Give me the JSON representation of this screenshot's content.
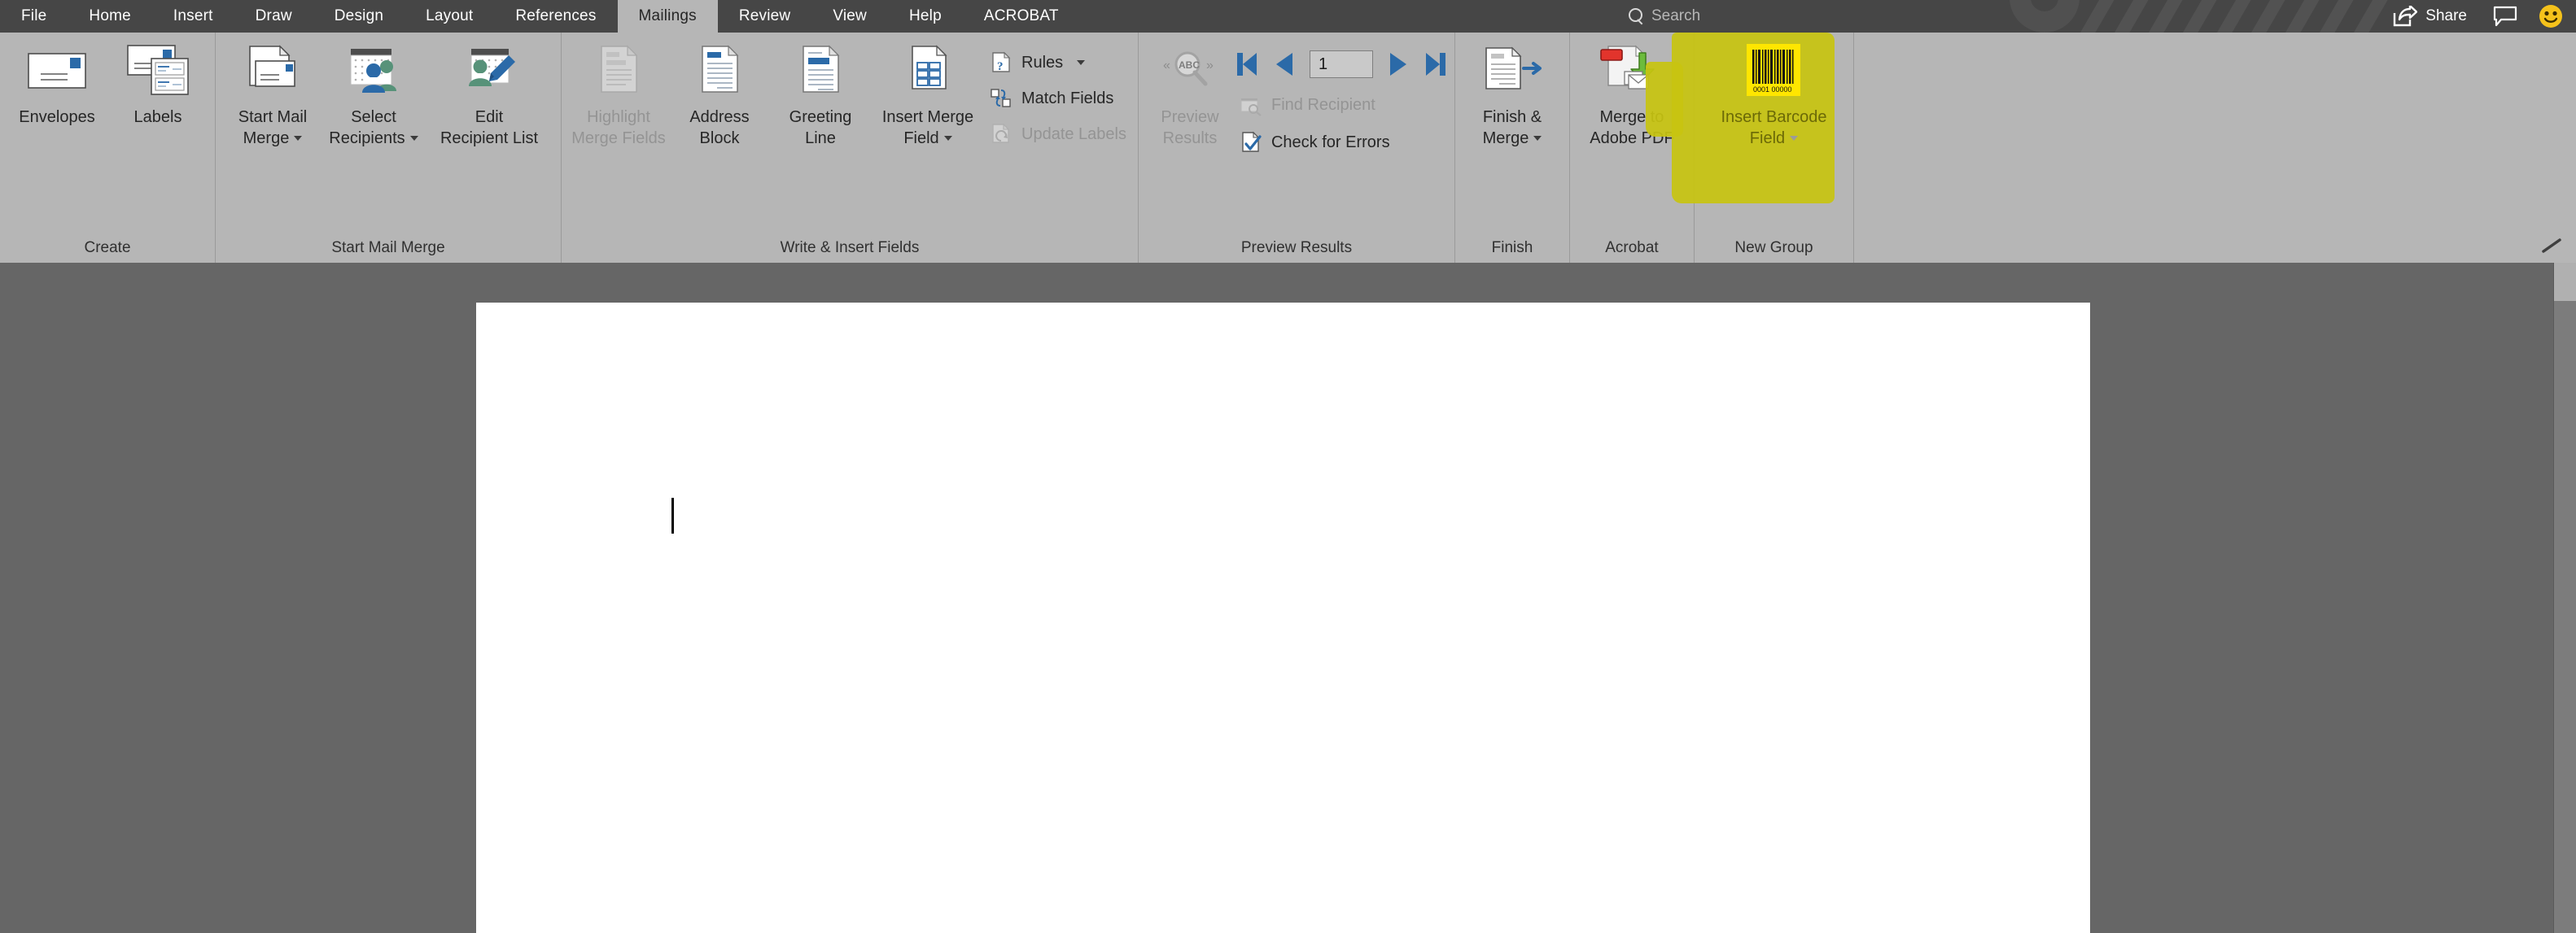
{
  "titlebar": {
    "tabs": [
      {
        "label": "File",
        "active": false
      },
      {
        "label": "Home",
        "active": false
      },
      {
        "label": "Insert",
        "active": false
      },
      {
        "label": "Draw",
        "active": false
      },
      {
        "label": "Design",
        "active": false
      },
      {
        "label": "Layout",
        "active": false
      },
      {
        "label": "References",
        "active": false
      },
      {
        "label": "Mailings",
        "active": true
      },
      {
        "label": "Review",
        "active": false
      },
      {
        "label": "View",
        "active": false
      },
      {
        "label": "Help",
        "active": false
      },
      {
        "label": "ACROBAT",
        "active": false
      }
    ],
    "search_placeholder": "Search",
    "search_icon": "search-icon",
    "share_label": "Share",
    "share_icon": "share-arrow-icon",
    "comments_icon": "comment-bubble-icon",
    "account_icon": "smiley-face-icon",
    "background_color": "#464646",
    "active_tab_color": "#b6b6b6"
  },
  "ribbon": {
    "background_color": "#b6b6b6",
    "collapse_icon": "collapse-ribbon-arrow-icon",
    "groups": [
      {
        "name": "create",
        "label": "Create",
        "buttons": [
          {
            "id": "envelopes",
            "label": "Envelopes",
            "icon": "envelope-icon",
            "disabled": false,
            "dropdown": false
          },
          {
            "id": "labels",
            "label": "Labels",
            "icon": "labels-icon",
            "disabled": false,
            "dropdown": false
          }
        ]
      },
      {
        "name": "start-mail-merge",
        "label": "Start Mail Merge",
        "buttons": [
          {
            "id": "start-mail-merge",
            "label": "Start Mail\nMerge",
            "icon": "start-mail-merge-icon",
            "disabled": false,
            "dropdown": true
          },
          {
            "id": "select-recipients",
            "label": "Select\nRecipients",
            "icon": "select-recipients-icon",
            "disabled": false,
            "dropdown": true
          },
          {
            "id": "edit-recipient-list",
            "label": "Edit\nRecipient List",
            "icon": "edit-recipient-list-icon",
            "disabled": false,
            "dropdown": false
          }
        ]
      },
      {
        "name": "write-insert-fields",
        "label": "Write & Insert Fields",
        "buttons": [
          {
            "id": "highlight-merge-fields",
            "label": "Highlight\nMerge Fields",
            "icon": "highlight-merge-fields-icon",
            "disabled": true,
            "dropdown": false
          },
          {
            "id": "address-block",
            "label": "Address\nBlock",
            "icon": "address-block-icon",
            "disabled": false,
            "dropdown": false
          },
          {
            "id": "greeting-line",
            "label": "Greeting\nLine",
            "icon": "greeting-line-icon",
            "disabled": false,
            "dropdown": false
          },
          {
            "id": "insert-merge-field",
            "label": "Insert Merge\nField",
            "icon": "insert-merge-field-icon",
            "disabled": false,
            "dropdown": true
          }
        ],
        "small_buttons": [
          {
            "id": "rules",
            "label": "Rules",
            "icon": "rules-icon",
            "disabled": false,
            "dropdown": true
          },
          {
            "id": "match-fields",
            "label": "Match Fields",
            "icon": "match-fields-icon",
            "disabled": false,
            "dropdown": false
          },
          {
            "id": "update-labels",
            "label": "Update Labels",
            "icon": "update-labels-icon",
            "disabled": true,
            "dropdown": false
          }
        ]
      },
      {
        "name": "preview-results",
        "label": "Preview Results",
        "buttons": [
          {
            "id": "preview-results",
            "label": "Preview\nResults",
            "icon": "preview-results-icon",
            "disabled": true,
            "dropdown": false
          }
        ],
        "navigation": {
          "first_icon": "first-record-icon",
          "previous_icon": "previous-record-icon",
          "record_number": "1",
          "next_icon": "next-record-icon",
          "last_icon": "last-record-icon"
        },
        "small_buttons": [
          {
            "id": "find-recipient",
            "label": "Find Recipient",
            "icon": "find-recipient-icon",
            "disabled": true,
            "dropdown": false
          },
          {
            "id": "check-for-errors",
            "label": "Check for Errors",
            "icon": "check-for-errors-icon",
            "disabled": false,
            "dropdown": false
          }
        ]
      },
      {
        "name": "finish",
        "label": "Finish",
        "buttons": [
          {
            "id": "finish-and-merge",
            "label": "Finish &\nMerge",
            "icon": "finish-and-merge-icon",
            "disabled": false,
            "dropdown": true
          }
        ]
      },
      {
        "name": "acrobat",
        "label": "Acrobat",
        "buttons": [
          {
            "id": "merge-to-adobe-pdf",
            "label": "Merge to\nAdobe PDF",
            "icon": "merge-to-adobe-pdf-icon",
            "disabled": false,
            "dropdown": false
          }
        ]
      },
      {
        "name": "new-group",
        "label": "New Group",
        "highlighted": true,
        "highlight_color": "#c8c410",
        "buttons": [
          {
            "id": "insert-barcode-field",
            "label": "Insert Barcode\nField",
            "icon": "barcode-icon",
            "disabled": false,
            "dropdown": true
          }
        ]
      }
    ]
  },
  "document": {
    "page_background": "#ffffff",
    "canvas_background": "#666666",
    "text_cursor": "text-caret",
    "content": ""
  },
  "scrollbar": {
    "track_color": "#7c7c7c",
    "thumb_color": "#b0b0b0"
  }
}
